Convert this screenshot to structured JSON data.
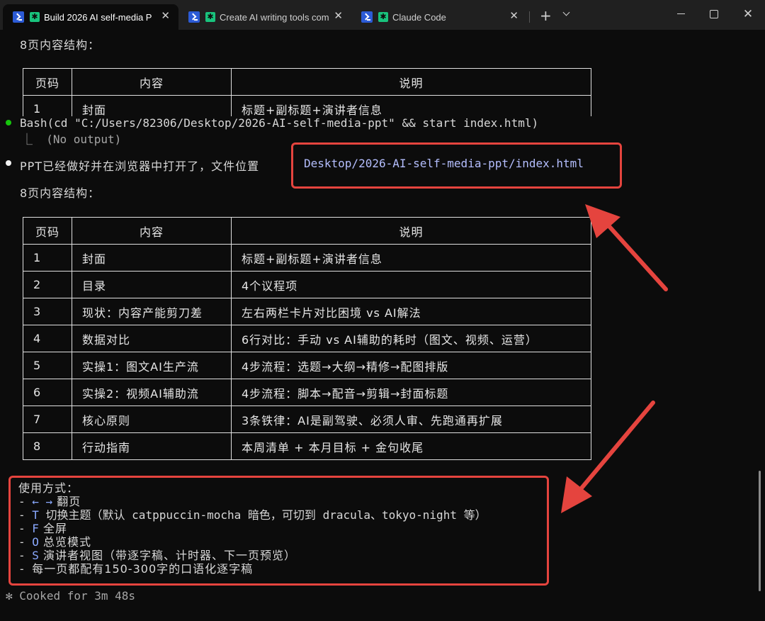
{
  "tabs": [
    {
      "title": "Build 2026 AI self-media P",
      "close": "✕"
    },
    {
      "title": "Create AI writing tools com",
      "close": "✕"
    },
    {
      "title": "Claude Code",
      "close": "✕"
    }
  ],
  "tabbar": {
    "new_tab": "+",
    "win_close": "✕"
  },
  "heading": "8页内容结构：",
  "bash": {
    "command": "Bash(cd \"C:/Users/82306/Desktop/2026-AI-self-media-ppt\" && start index.html)",
    "output": "⎿  (No output)"
  },
  "message": {
    "text": "PPT已经做好并在浏览器中打开了，文件位置",
    "path": "Desktop/2026-AI-self-media-ppt/index.html"
  },
  "table": {
    "headers": [
      "页码",
      "内容",
      "说明"
    ],
    "rows": [
      {
        "num": "1",
        "content": "封面",
        "desc": "标题+副标题+演讲者信息"
      },
      {
        "num": "2",
        "content": "目录",
        "desc": "4个议程项"
      },
      {
        "num": "3",
        "content": "现状：内容产能剪刀差",
        "desc": "左右两栏卡片对比困境 vs AI解法"
      },
      {
        "num": "4",
        "content": "数据对比",
        "desc": "6行对比：手动 vs AI辅助的耗时（图文、视频、运营）"
      },
      {
        "num": "5",
        "content": "实操1：图文AI生产流",
        "desc": "4步流程：选题→大纲→精修→配图排版"
      },
      {
        "num": "6",
        "content": "实操2：视频AI辅助流",
        "desc": "4步流程：脚本→配音→剪辑→封面标题"
      },
      {
        "num": "7",
        "content": "核心原则",
        "desc": "3条铁律：AI是副驾驶、必须人审、先跑通再扩展"
      },
      {
        "num": "8",
        "content": "行动指南",
        "desc": "本周清单 + 本月目标 + 金句收尾"
      }
    ]
  },
  "usage": {
    "title": "使用方式：",
    "items": [
      {
        "dash": "- ",
        "key": "← →",
        "text": " 翻页"
      },
      {
        "dash": "- ",
        "key": "T",
        "text": " 切换主题（默认 catppuccin-mocha 暗色，可切到 dracula、tokyo-night 等）"
      },
      {
        "dash": "- ",
        "key": "F",
        "text": " 全屏"
      },
      {
        "dash": "- ",
        "key": "O",
        "text": " 总览模式"
      },
      {
        "dash": "- ",
        "key": "S",
        "text": " 演讲者视图（带逐字稿、计时器、下一页预览）"
      },
      {
        "dash": "- ",
        "key": "",
        "text": "每一页都配有150-300字的口语化逐字稿"
      }
    ]
  },
  "footer": {
    "spinner": "✻",
    "text": "Cooked for 3m 48s"
  },
  "colors": {
    "highlight": "#e5443e",
    "path": "#b4befe",
    "success_dot": "#16c60c"
  }
}
